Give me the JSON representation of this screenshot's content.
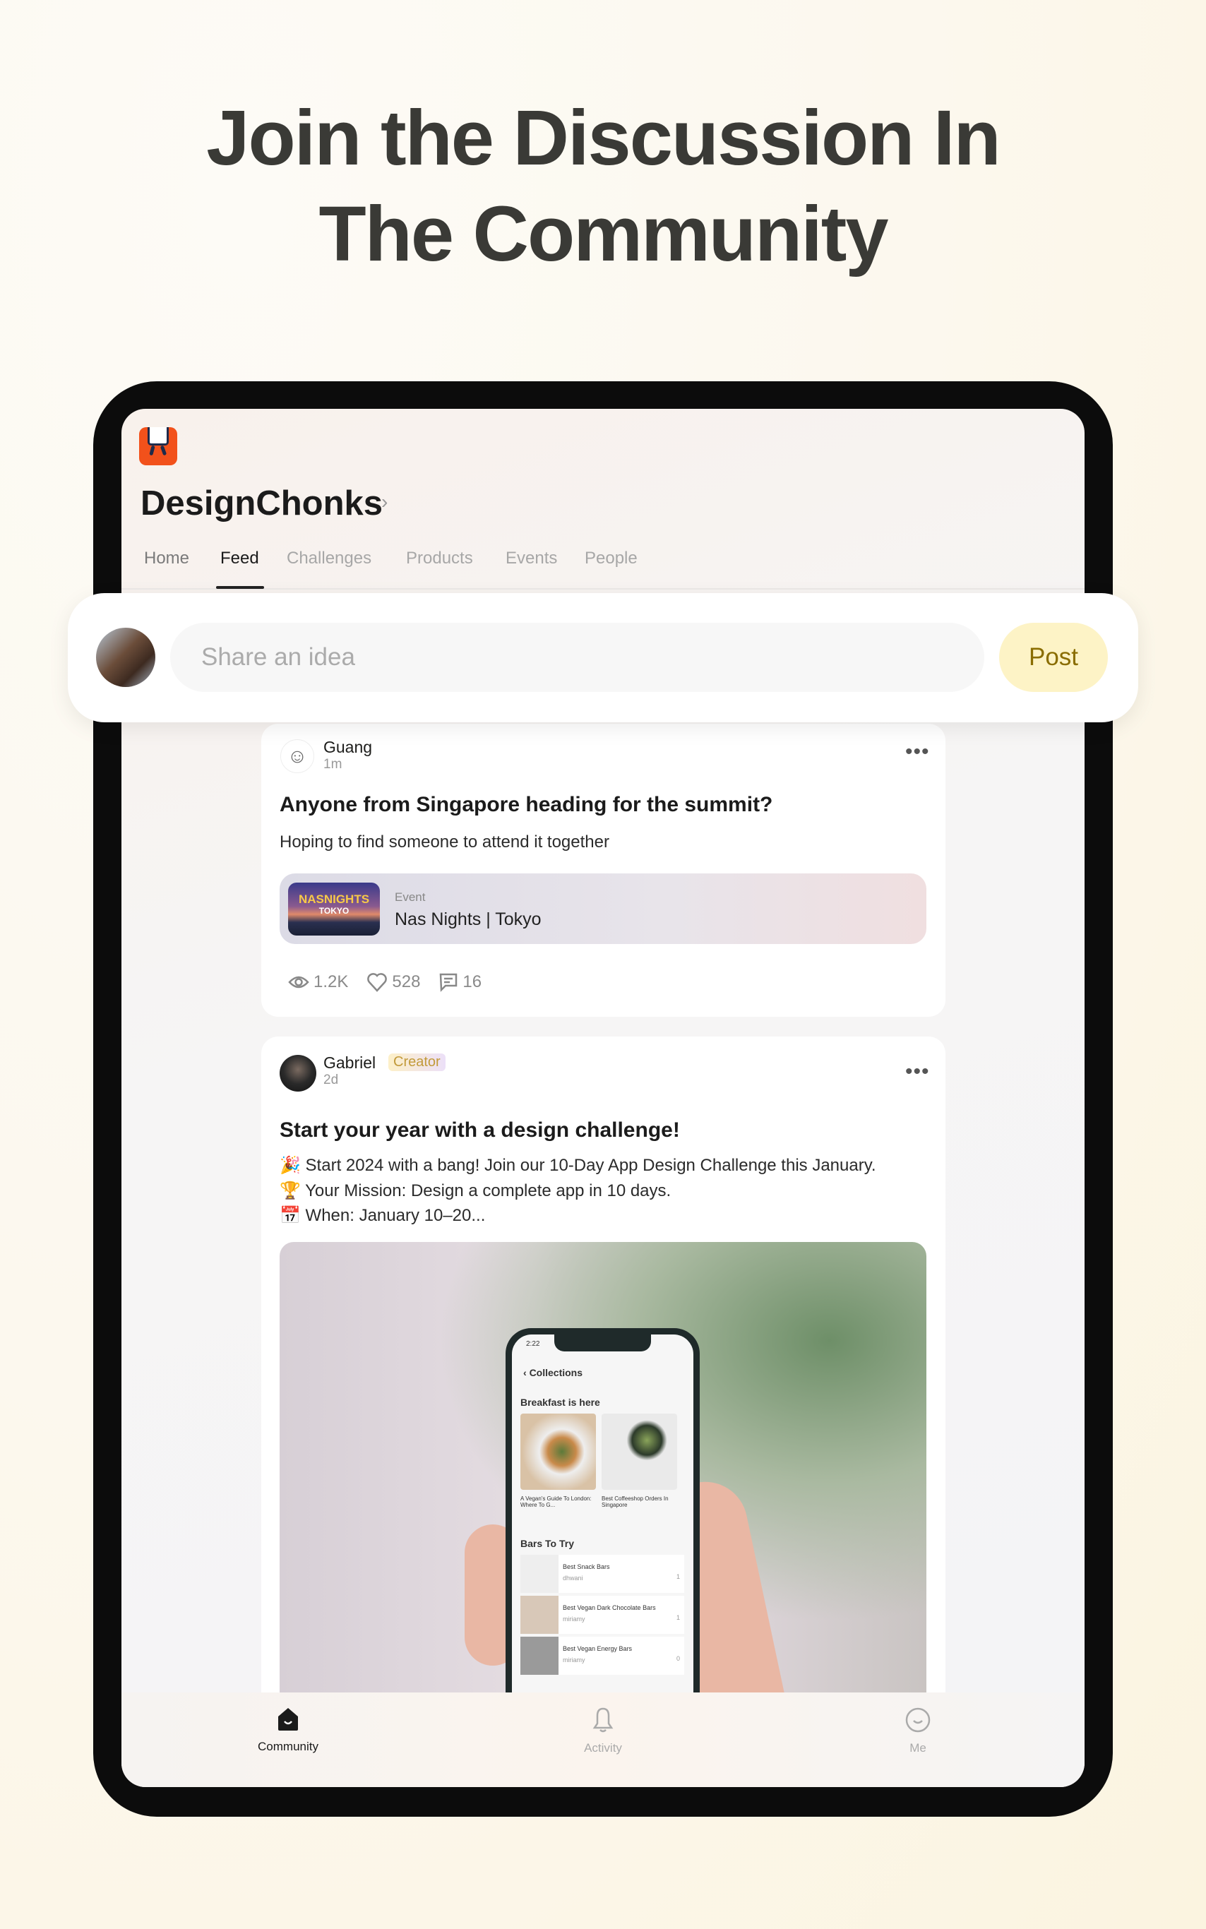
{
  "headline": {
    "line1": "Join the Discussion In",
    "line2": "The Community"
  },
  "community": {
    "name": "DesignChonks",
    "brand_color": "#f2511b"
  },
  "tabs": [
    {
      "label": "Home"
    },
    {
      "label": "Feed",
      "active": true
    },
    {
      "label": "Challenges"
    },
    {
      "label": "Products"
    },
    {
      "label": "Events"
    },
    {
      "label": "People"
    }
  ],
  "composer": {
    "placeholder": "Share an idea",
    "value": "",
    "post_label": "Post",
    "post_color": "#fdf3c6"
  },
  "posts": [
    {
      "author": "Guang",
      "time": "1m",
      "title": "Anyone from Singapore heading for the summit?",
      "body": "Hoping to find someone to attend it together",
      "event": {
        "thumb_line1": "NASNIGHTS",
        "thumb_line2": "TOKYO",
        "type": "Event",
        "name": "Nas Nights | Tokyo"
      },
      "stats": {
        "views": "1.2K",
        "likes": "528",
        "comments": "16"
      }
    },
    {
      "author": "Gabriel",
      "badge": "Creator",
      "time": "2d",
      "title": "Start your year with a design challenge!",
      "lines": [
        "🎉 Start 2024 with a bang! Join our 10-Day App Design Challenge this January.",
        "🏆 Your Mission: Design a complete app in 10 days.",
        "📅 When: January 10–20..."
      ],
      "image_phone": {
        "time": "2:22",
        "back": "Collections",
        "section1": "Breakfast is here",
        "item1": "A Vegan's Guide To London: Where To G...",
        "item2": "Best Coffeeshop Orders In Singapore",
        "section2": "Bars To Try",
        "list": [
          {
            "title": "Best Snack Bars",
            "user": "dhwani",
            "likes": "1"
          },
          {
            "title": "Best Vegan Dark Chocolate Bars",
            "user": "miriamy",
            "likes": "1"
          },
          {
            "title": "Best Vegan Energy Bars",
            "user": "miriamy",
            "likes": "0"
          }
        ]
      }
    }
  ],
  "bottom_nav": [
    {
      "label": "Community",
      "icon": "community-icon",
      "active": true
    },
    {
      "label": "Activity",
      "icon": "bell-icon"
    },
    {
      "label": "Me",
      "icon": "smiley-icon"
    }
  ]
}
